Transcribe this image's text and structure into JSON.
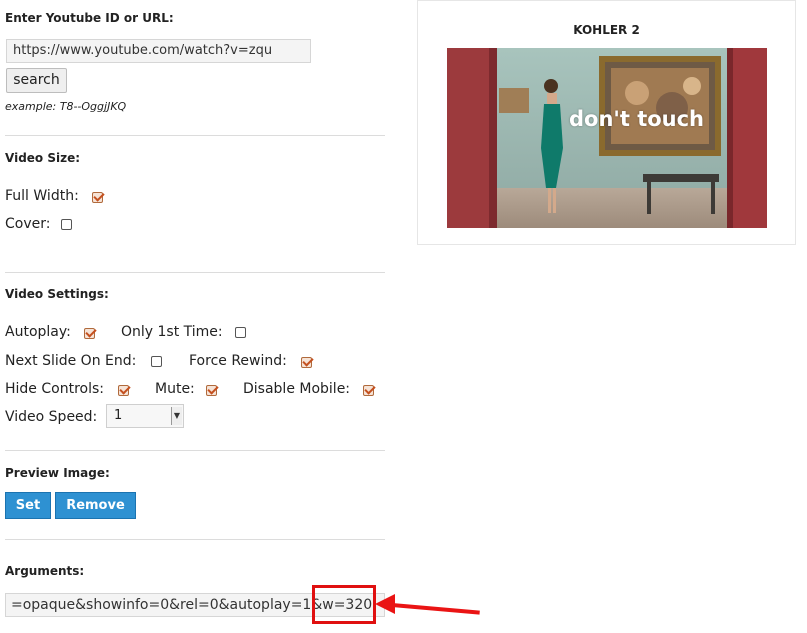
{
  "youtube": {
    "heading": "Enter Youtube ID or URL:",
    "url_value": "https://www.youtube.com/watch?v=zqu",
    "search_label": "search",
    "example": "example: T8--OggjJKQ"
  },
  "video_size": {
    "heading": "Video Size:",
    "full_width": {
      "label": "Full Width:",
      "checked": true
    },
    "cover": {
      "label": "Cover:",
      "checked": false
    }
  },
  "video_settings": {
    "heading": "Video Settings:",
    "autoplay": {
      "label": "Autoplay:",
      "checked": true
    },
    "only_first": {
      "label": "Only 1st Time:",
      "checked": false
    },
    "next_slide": {
      "label": "Next Slide On End:",
      "checked": false
    },
    "force_rewind": {
      "label": "Force Rewind:",
      "checked": true
    },
    "hide_controls": {
      "label": "Hide Controls:",
      "checked": true
    },
    "mute": {
      "label": "Mute:",
      "checked": true
    },
    "disable_mobile": {
      "label": "Disable Mobile:",
      "checked": true
    },
    "speed": {
      "label": "Video Speed:",
      "value": "1"
    }
  },
  "preview_image": {
    "heading": "Preview Image:",
    "set_label": "Set",
    "remove_label": "Remove"
  },
  "arguments": {
    "heading": "Arguments:",
    "value": "=opaque&showinfo=0&rel=0&autoplay=1&w=320"
  },
  "preview": {
    "title": "KOHLER 2",
    "caption": "don't touch"
  },
  "colors": {
    "accent_blue": "#2e91d2",
    "annotation_red": "#e01010",
    "checkbox_check": "#c4501f"
  }
}
